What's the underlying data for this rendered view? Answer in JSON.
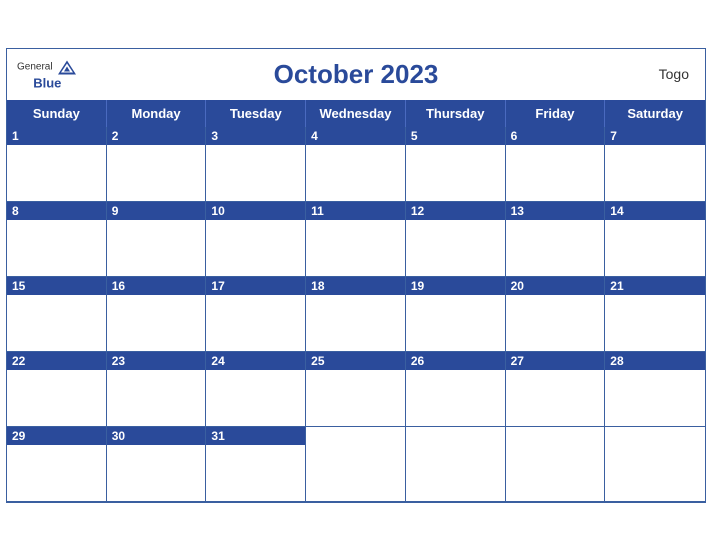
{
  "header": {
    "logo_general": "General",
    "logo_blue": "Blue",
    "title": "October 2023",
    "country": "Togo"
  },
  "days_of_week": [
    "Sunday",
    "Monday",
    "Tuesday",
    "Wednesday",
    "Thursday",
    "Friday",
    "Saturday"
  ],
  "weeks": [
    [
      1,
      2,
      3,
      4,
      5,
      6,
      7
    ],
    [
      8,
      9,
      10,
      11,
      12,
      13,
      14
    ],
    [
      15,
      16,
      17,
      18,
      19,
      20,
      21
    ],
    [
      22,
      23,
      24,
      25,
      26,
      27,
      28
    ],
    [
      29,
      30,
      31,
      null,
      null,
      null,
      null
    ]
  ]
}
